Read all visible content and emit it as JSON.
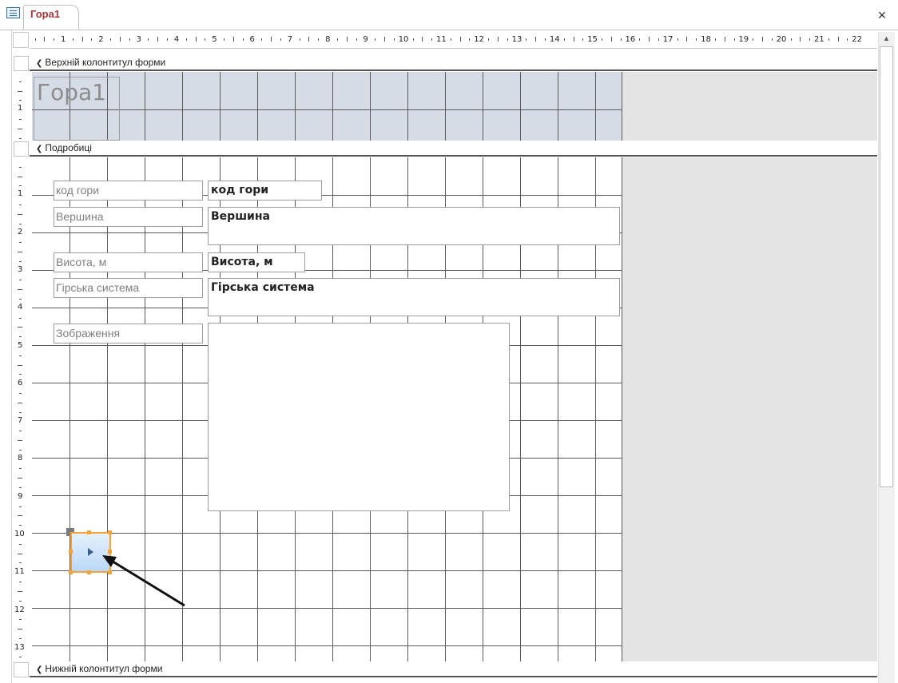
{
  "window": {
    "tab_title": "Гора1",
    "close_glyph": "×",
    "icon": "form-icon"
  },
  "ruler": {
    "top_labels": [
      "1",
      "2",
      "3",
      "4",
      "5",
      "6",
      "7",
      "8",
      "9",
      "10",
      "11",
      "12",
      "13",
      "14",
      "15",
      "16",
      "17",
      "18",
      "19",
      "20",
      "21",
      "22"
    ],
    "left_labels": [
      "1",
      "2",
      "3",
      "4",
      "5",
      "6",
      "7",
      "8",
      "9",
      "10",
      "11",
      "12",
      "13"
    ]
  },
  "sections": {
    "form_header": "Верхній колонтитул форми",
    "detail": "Подробиці",
    "form_footer": "Нижній колонтитул форми"
  },
  "header": {
    "title_label": "Гора1"
  },
  "detail": {
    "fields": [
      {
        "label": "код гори",
        "value": "код гори"
      },
      {
        "label": "Вершина",
        "value": "Вершина"
      },
      {
        "label": "Висота, м",
        "value": "Висота, м"
      },
      {
        "label": "Гірська система",
        "value": "Гірська система"
      },
      {
        "label": "Зображення",
        "value": ""
      }
    ],
    "nav_button_icon": "play-triangle-icon"
  },
  "colors": {
    "tab_text": "#a4373a",
    "header_bg": "#d6dce5",
    "selection": "#f7a23b",
    "button_fill": "#b9d8f7"
  }
}
